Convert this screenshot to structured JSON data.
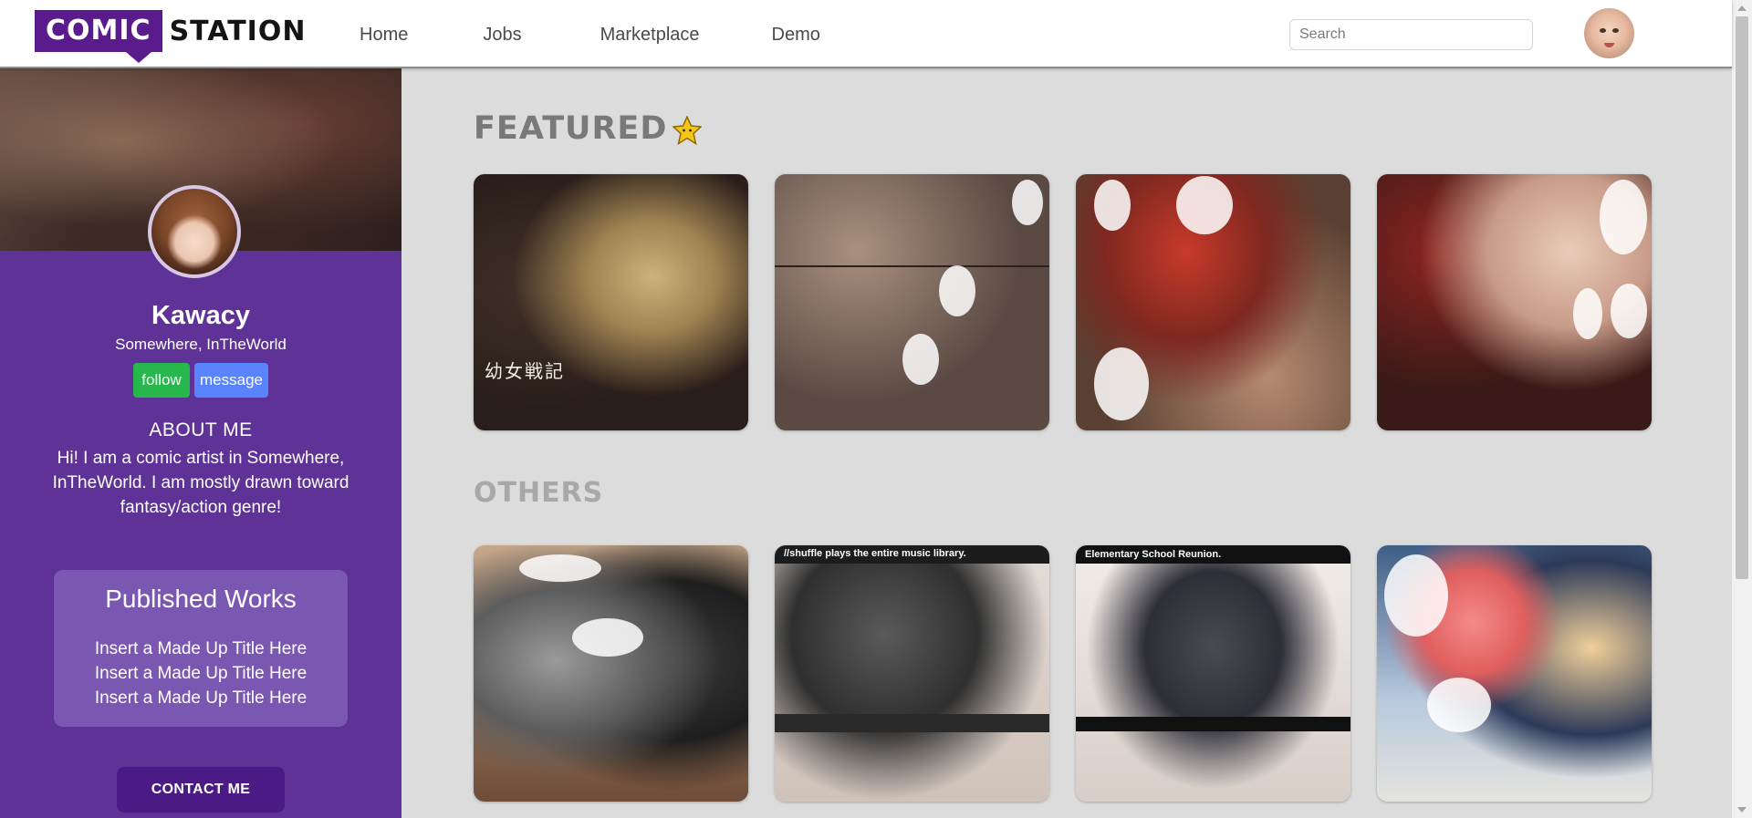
{
  "nav": {
    "logo_part1": "COMIC",
    "logo_part2": "STATION",
    "links": [
      "Home",
      "Jobs",
      "Marketplace",
      "Demo"
    ],
    "search_placeholder": "Search",
    "avatar_icon": "user-avatar-icon"
  },
  "profile": {
    "name": "Kawacy",
    "location": "Somewhere, InTheWorld",
    "follow_label": "follow",
    "message_label": "message",
    "about_title": "ABOUT ME",
    "about_text": "Hi! I am a comic artist in Somewhere, InTheWorld. I am mostly drawn toward fantasy/action genre!",
    "works_title": "Published Works",
    "works": [
      "Insert a Made Up Title Here",
      "Insert a Made Up Title Here",
      "Insert a Made Up Title Here"
    ],
    "contact_label": "CONTACT ME"
  },
  "main": {
    "featured_title": "FEATURED",
    "featured_icon": "star-icon",
    "others_title": "OTHERS",
    "featured": [
      {
        "name": "featured-comic-1",
        "caption": "幼女戦記"
      },
      {
        "name": "featured-comic-2",
        "caption": ""
      },
      {
        "name": "featured-comic-3",
        "caption": ""
      },
      {
        "name": "featured-comic-4",
        "caption": ""
      }
    ],
    "others": [
      {
        "name": "other-comic-1",
        "caption": ""
      },
      {
        "name": "other-comic-2",
        "caption": "//shuffle plays the entire music library."
      },
      {
        "name": "other-comic-3",
        "caption": "Elementary School Reunion."
      },
      {
        "name": "other-comic-4",
        "caption": ""
      }
    ]
  },
  "colors": {
    "brand_purple": "#5a1b8c",
    "sidebar_bg": "#5e3296",
    "works_bg": "#7a58b2",
    "follow_green": "#27b74c",
    "message_blue": "#5a84ff",
    "contact_bg": "#4a1a85",
    "main_bg": "#dcdcdc"
  }
}
